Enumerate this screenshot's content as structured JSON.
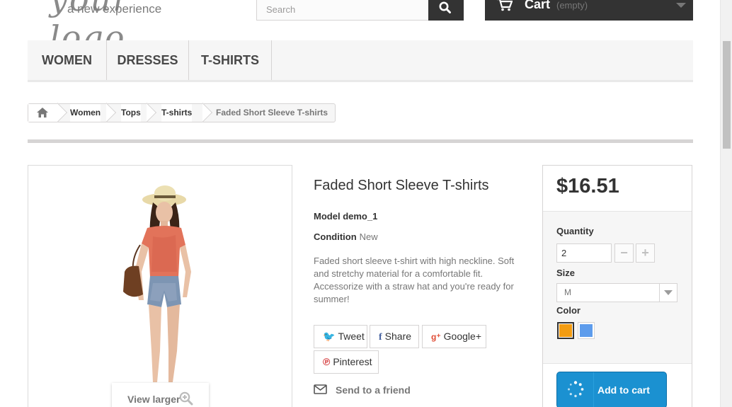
{
  "header": {
    "logo_script": "your logo",
    "logo_tagline": "a new experience",
    "search_placeholder": "Search",
    "cart_label": "Cart",
    "cart_status": "(empty)"
  },
  "nav": {
    "items": [
      {
        "label": "Women"
      },
      {
        "label": "Dresses"
      },
      {
        "label": "T-shirts"
      }
    ]
  },
  "breadcrumb": {
    "items": [
      "Women",
      "Tops",
      "T-shirts"
    ],
    "current": "Faded Short Sleeve T-shirts"
  },
  "product": {
    "title": "Faded Short Sleeve T-shirts",
    "model_label": "Model",
    "model_value": "demo_1",
    "condition_label": "Condition",
    "condition_value": "New",
    "description": "Faded short sleeve t-shirt with high neckline. Soft and stretchy material for a comfortable fit. Accessorize with a straw hat and you're ready for summer!",
    "view_larger": "View larger"
  },
  "social": {
    "tweet": "Tweet",
    "share": "Share",
    "google": "Google+",
    "pinterest": "Pinterest",
    "send_to_friend": "Send to a friend"
  },
  "buy_box": {
    "price": "$16.51",
    "quantity_label": "Quantity",
    "quantity_value": "2",
    "size_label": "Size",
    "size_value": "M",
    "color_label": "Color",
    "colors": [
      {
        "name": "orange",
        "hex": "#f39c11",
        "selected": true
      },
      {
        "name": "blue",
        "hex": "#5d9cec",
        "selected": false
      }
    ],
    "add_to_cart": "Add to cart"
  },
  "accent": {
    "add_to_cart_bg": "#1b91d1",
    "dark": "#333333"
  }
}
